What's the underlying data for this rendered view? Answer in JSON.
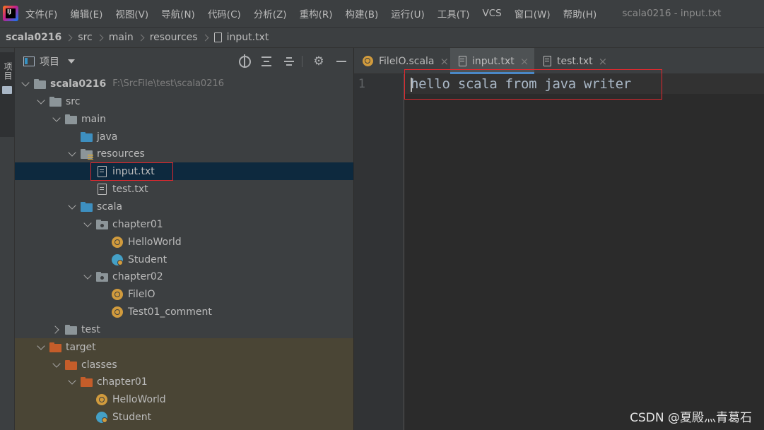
{
  "app": {
    "logo_text": "IJ",
    "window_title": "scala0216 - input.txt"
  },
  "menu": [
    {
      "label": "文件(F)"
    },
    {
      "label": "编辑(E)"
    },
    {
      "label": "视图(V)"
    },
    {
      "label": "导航(N)"
    },
    {
      "label": "代码(C)"
    },
    {
      "label": "分析(Z)"
    },
    {
      "label": "重构(R)"
    },
    {
      "label": "构建(B)"
    },
    {
      "label": "运行(U)"
    },
    {
      "label": "工具(T)"
    },
    {
      "label": "VCS"
    },
    {
      "label": "窗口(W)"
    },
    {
      "label": "帮助(H)"
    }
  ],
  "breadcrumb": [
    "scala0216",
    "src",
    "main",
    "resources",
    "input.txt"
  ],
  "tool_strip": {
    "label": "项目"
  },
  "project_panel": {
    "title": "项目",
    "icons": {
      "locate": "locate-icon",
      "expand": "expand-all-icon",
      "collapse": "collapse-all-icon",
      "settings": "gear-icon",
      "hide": "minimize-icon"
    }
  },
  "tree": [
    {
      "label": "scala0216",
      "path": "F:\\SrcFile\\test\\scala0216",
      "icon": "module-folder-icon",
      "arrow": "down",
      "depth": 0,
      "bold": true
    },
    {
      "label": "src",
      "icon": "folder-icon",
      "arrow": "down",
      "depth": 1
    },
    {
      "label": "main",
      "icon": "folder-icon",
      "arrow": "down",
      "depth": 2
    },
    {
      "label": "java",
      "icon": "source-folder-icon",
      "arrow": "none",
      "depth": 3
    },
    {
      "label": "resources",
      "icon": "resources-folder-icon",
      "arrow": "down",
      "depth": 3
    },
    {
      "label": "input.txt",
      "icon": "text-file-icon",
      "arrow": "none",
      "depth": 4,
      "selected": true
    },
    {
      "label": "test.txt",
      "icon": "text-file-icon",
      "arrow": "none",
      "depth": 4
    },
    {
      "label": "scala",
      "icon": "source-folder-icon",
      "arrow": "down",
      "depth": 3
    },
    {
      "label": "chapter01",
      "icon": "package-icon",
      "arrow": "down",
      "depth": 4
    },
    {
      "label": "HelloWorld",
      "icon": "scala-object-icon",
      "arrow": "none",
      "depth": 5
    },
    {
      "label": "Student",
      "icon": "scala-class-icon",
      "arrow": "none",
      "depth": 5
    },
    {
      "label": "chapter02",
      "icon": "package-icon",
      "arrow": "down",
      "depth": 4
    },
    {
      "label": "FileIO",
      "icon": "scala-object-icon",
      "arrow": "none",
      "depth": 5
    },
    {
      "label": "Test01_comment",
      "icon": "scala-object-icon",
      "arrow": "none",
      "depth": 5
    },
    {
      "label": "test",
      "icon": "folder-icon",
      "arrow": "right",
      "depth": 2
    },
    {
      "label": "target",
      "icon": "excluded-folder-icon",
      "arrow": "down",
      "depth": 1,
      "excluded": true
    },
    {
      "label": "classes",
      "icon": "excluded-folder-icon",
      "arrow": "down",
      "depth": 2,
      "excluded": true
    },
    {
      "label": "chapter01",
      "icon": "excluded-folder-icon",
      "arrow": "down",
      "depth": 3,
      "excluded": true
    },
    {
      "label": "HelloWorld",
      "icon": "scala-object-icon",
      "arrow": "none",
      "depth": 4,
      "excluded": true
    },
    {
      "label": "Student",
      "icon": "scala-class-icon",
      "arrow": "none",
      "depth": 4,
      "excluded": true
    }
  ],
  "tabs": [
    {
      "label": "FileIO.scala",
      "icon": "scala-object-icon",
      "close": "×",
      "active": false
    },
    {
      "label": "input.txt",
      "icon": "text-file-icon",
      "close": "×",
      "active": true
    },
    {
      "label": "test.txt",
      "icon": "text-file-icon",
      "close": "×",
      "active": false
    }
  ],
  "editor": {
    "line_number": "1",
    "content": "hello scala from java writer"
  },
  "watermark": "CSDN @夏殿灬青葛石",
  "colors": {
    "highlight": "#e0282e",
    "selection": "#0d293e",
    "excluded_bg": "#4a4535",
    "accent": "#4a88c7"
  }
}
